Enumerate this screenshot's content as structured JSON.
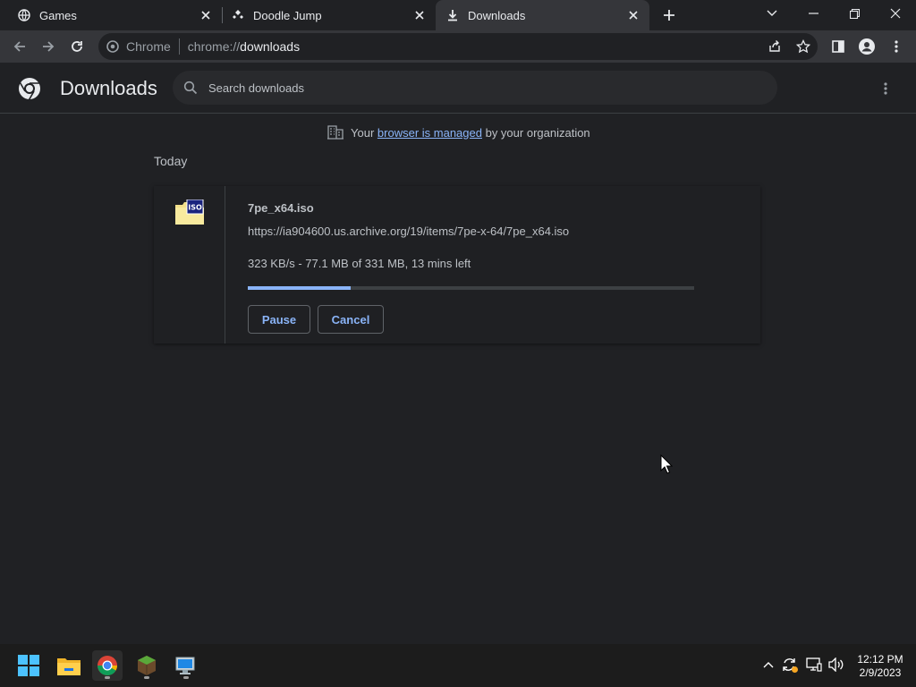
{
  "tabs": [
    {
      "label": "Games",
      "icon": "globe-icon"
    },
    {
      "label": "Doodle Jump",
      "icon": "doodle-jump-icon"
    },
    {
      "label": "Downloads",
      "icon": "download-icon",
      "active": true
    }
  ],
  "omnibox": {
    "site_chip": "Chrome",
    "url_prefix": "chrome://",
    "url_host": "downloads"
  },
  "downloads": {
    "title": "Downloads",
    "search_placeholder": "Search downloads",
    "managed_prefix": "Your",
    "managed_link": "browser is managed",
    "managed_suffix": "by your organization",
    "date_header": "Today",
    "item": {
      "filename": "7pe_x64.iso",
      "url": "https://ia904600.us.archive.org/19/items/7pe-x-64/7pe_x64.iso",
      "status": "323 KB/s - 77.1 MB of 331 MB, 13 mins left",
      "progress_fraction": 0.23,
      "icon_label": "ISO",
      "pause_label": "Pause",
      "cancel_label": "Cancel"
    }
  },
  "taskbar": {
    "apps": [
      "windows-start-icon",
      "file-explorer-icon",
      "chrome-icon",
      "minecraft-icon",
      "remote-desktop-icon"
    ],
    "time": "12:12 PM",
    "date": "2/9/2023"
  },
  "colors": {
    "accent": "#8ab4f8",
    "background": "#202124",
    "toolbar": "#35363a"
  }
}
